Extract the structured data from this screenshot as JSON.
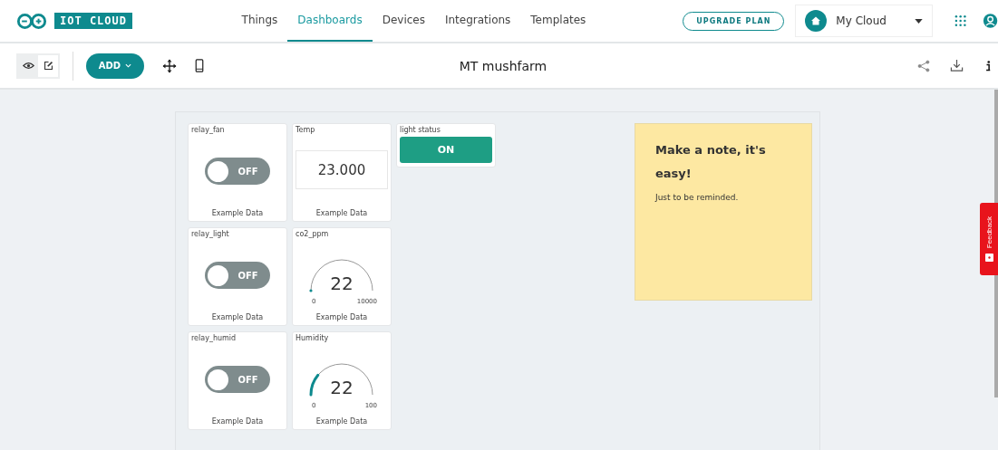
{
  "brand": {
    "logo_text": "IOT CLOUD"
  },
  "nav": [
    {
      "label": "Things",
      "selected": false
    },
    {
      "label": "Dashboards",
      "selected": true
    },
    {
      "label": "Devices",
      "selected": false
    },
    {
      "label": "Integrations",
      "selected": false
    },
    {
      "label": "Templates",
      "selected": false
    }
  ],
  "upgrade_button": "UPGRADE PLAN",
  "space_selector": {
    "value": "My Cloud"
  },
  "toolbar": {
    "view_mode_selected": false,
    "edit_mode_selected": true,
    "add_button": "ADD",
    "title": "MT mushfarm"
  },
  "widget_columns": [
    [
      {
        "kind": "switch",
        "title": "relay_fan",
        "on": false,
        "state_label": "OFF",
        "caption": "Example Data"
      },
      {
        "kind": "switch",
        "title": "relay_light",
        "on": false,
        "state_label": "OFF",
        "caption": "Example Data"
      },
      {
        "kind": "switch",
        "title": "relay_humid",
        "on": false,
        "state_label": "OFF",
        "caption": "Example Data"
      }
    ],
    [
      {
        "kind": "value",
        "title": "Temp",
        "value": "23.000",
        "caption": "Example Data"
      },
      {
        "kind": "gauge",
        "title": "co2_ppm",
        "value": "22",
        "min": "0",
        "max": "10000",
        "caption": "Example Data"
      },
      {
        "kind": "gauge",
        "title": "Humidity",
        "value": "22",
        "level": 0.22,
        "min": "0",
        "max": "100",
        "caption": "Example Data"
      }
    ],
    [
      {
        "kind": "status",
        "title": "light status",
        "on": true,
        "state_label": "ON"
      }
    ]
  ],
  "note": {
    "title": "Make a note, it's easy!",
    "body": "Just to be reminded."
  },
  "feedback_tab": "Feedback"
}
